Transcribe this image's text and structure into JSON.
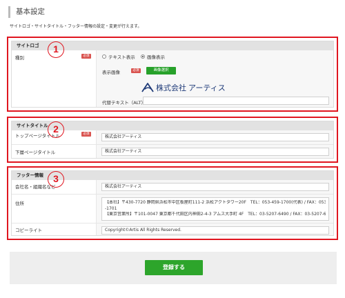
{
  "header": {
    "title": "基本設定",
    "description": "サイトロゴ・サイトタイトル・フッター情報の設定・変更が行えます。"
  },
  "badges": [
    "1",
    "2",
    "3"
  ],
  "logo_section": {
    "heading": "サイトロゴ",
    "type_label": "種別",
    "required": "必須",
    "option_text": "テキスト表示",
    "option_image": "画像表示",
    "selected_option": "画像表示",
    "image_label": "表示画像",
    "select_image_button": "画像選択",
    "logo_company_text": "株式会社 アーティス",
    "alt_label": "代替テキスト（ALT）",
    "alt_value": ""
  },
  "title_section": {
    "heading": "サイトタイトル",
    "top_label": "トップページタイトル",
    "top_value": "株式会社アーティス",
    "sub_label": "下層ページタイトル",
    "sub_value": "株式会社アーティス"
  },
  "footer_section": {
    "heading": "フッター情報",
    "company_label": "会社名・組織名など",
    "company_value": "株式会社アーティス",
    "address_label": "住所",
    "address_lines": [
      "【本社】〒430-7720 静岡県浜松市中区板屋町111-2 浜松アクトタワー20F　TEL：053-459-1700(代表) / FAX：053-459",
      "-1701",
      "【東京営業所】〒101-0047 東京都千代田区内神田2-4-3 アムス大手町 4F　TEL：03-5207-6490 / FAX：03-5207-6491"
    ],
    "copyright_label": "コピーライト",
    "copyright_value": "Copyright©Artis All Rights Reserved."
  },
  "submit_label": "登録する",
  "colors": {
    "highlight": "#e0151f",
    "button_green": "#27a12a",
    "required_red": "#d9534f",
    "logo_blue": "#1e3a78"
  }
}
